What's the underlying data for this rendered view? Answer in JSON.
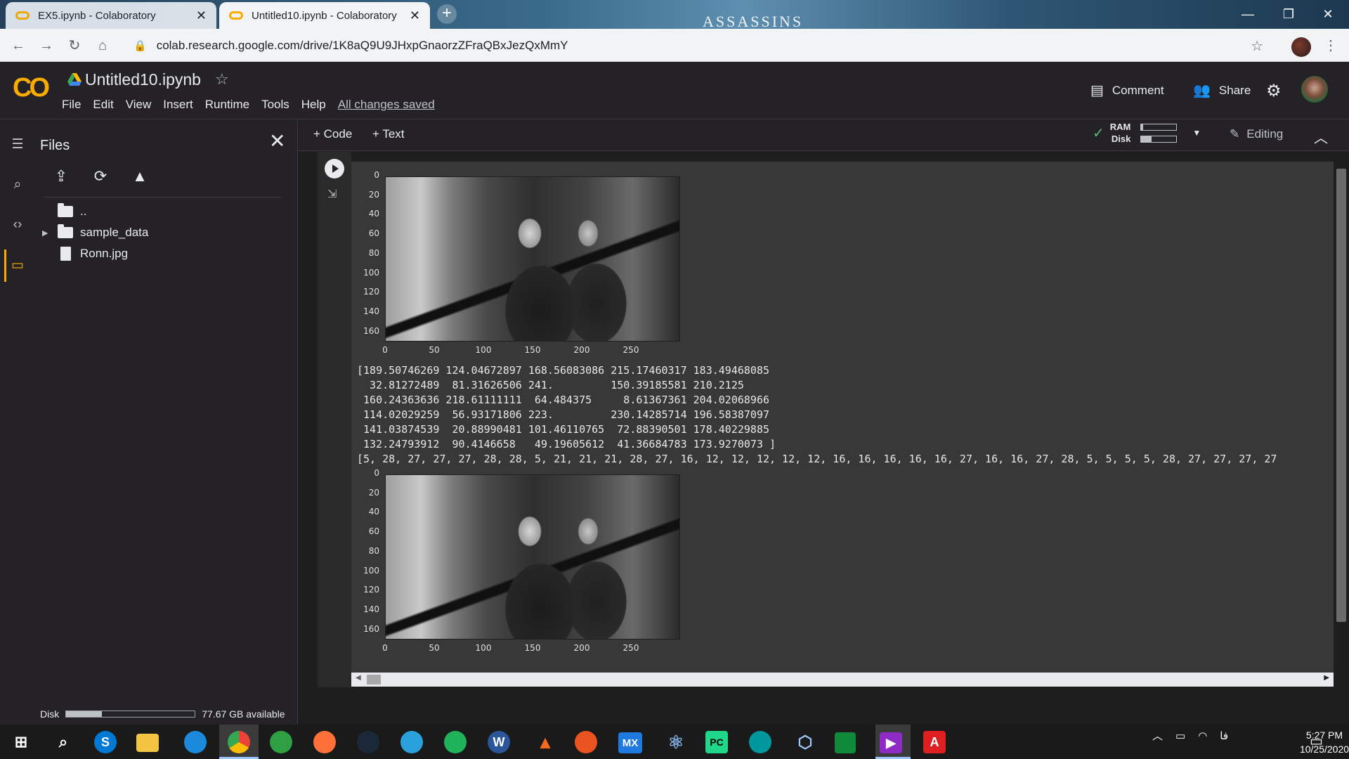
{
  "browser": {
    "tabs": [
      {
        "title": "EX5.ipynb - Colaboratory",
        "active": false
      },
      {
        "title": "Untitled10.ipynb - Colaboratory",
        "active": true
      }
    ],
    "new_tab": "+",
    "background_brand": "ASSASSINS",
    "window_controls": {
      "minimize": "—",
      "restore": "❐",
      "close": "✕"
    },
    "url": "colab.research.google.com/drive/1K8aQ9U9JHxpGnaorzZFraQBxJezQxMmY"
  },
  "colab": {
    "logo": "CO",
    "notebook_title": "Untitled10.ipynb",
    "menu": [
      "File",
      "Edit",
      "View",
      "Insert",
      "Runtime",
      "Tools",
      "Help"
    ],
    "save_status": "All changes saved",
    "comment_label": "Comment",
    "share_label": "Share"
  },
  "sidebar": {
    "title": "Files",
    "tree": [
      {
        "label": "..",
        "type": "parent"
      },
      {
        "label": "sample_data",
        "type": "folder"
      },
      {
        "label": "Ronn.jpg",
        "type": "file"
      }
    ],
    "disk_label": "Disk",
    "disk_available": "77.67 GB available",
    "disk_used_fraction": 0.28
  },
  "toolbar": {
    "add_code": "+ Code",
    "add_text": "+ Text",
    "ram_label": "RAM",
    "disk_label": "Disk",
    "ram_fraction": 0.05,
    "disk_fraction": 0.3,
    "editing_label": "Editing"
  },
  "output": {
    "plot_yticks": [
      "0",
      "20",
      "40",
      "60",
      "80",
      "100",
      "120",
      "140",
      "160"
    ],
    "plot_xticks": [
      "0",
      "50",
      "100",
      "150",
      "200",
      "250"
    ],
    "array_text": "[189.50746269 124.04672897 168.56083086 215.17460317 183.49468085\n  32.81272489  81.31626506 241.         150.39185581 210.2125\n 160.24363636 218.61111111  64.484375     8.61367361 204.02068966\n 114.02029259  56.93171806 223.         230.14285714 196.58387097\n 141.03874539  20.88990481 101.46110765  72.88390501 178.40229885\n 132.24793912  90.4146658   49.19605612  41.36684783 173.9270073 ]",
    "list_text": "[5, 28, 27, 27, 27, 28, 28, 5, 21, 21, 21, 28, 27, 16, 12, 12, 12, 12, 12, 16, 16, 16, 16, 16, 27, 16, 16, 27, 28, 5, 5, 5, 5, 28, 27, 27, 27, 27"
  },
  "taskbar": {
    "apps": [
      "S",
      "W",
      "MX",
      "PC",
      "A"
    ],
    "clock_time": "5:27 PM",
    "clock_date": "10/25/2020",
    "lang": "فا",
    "notifications": "4"
  }
}
